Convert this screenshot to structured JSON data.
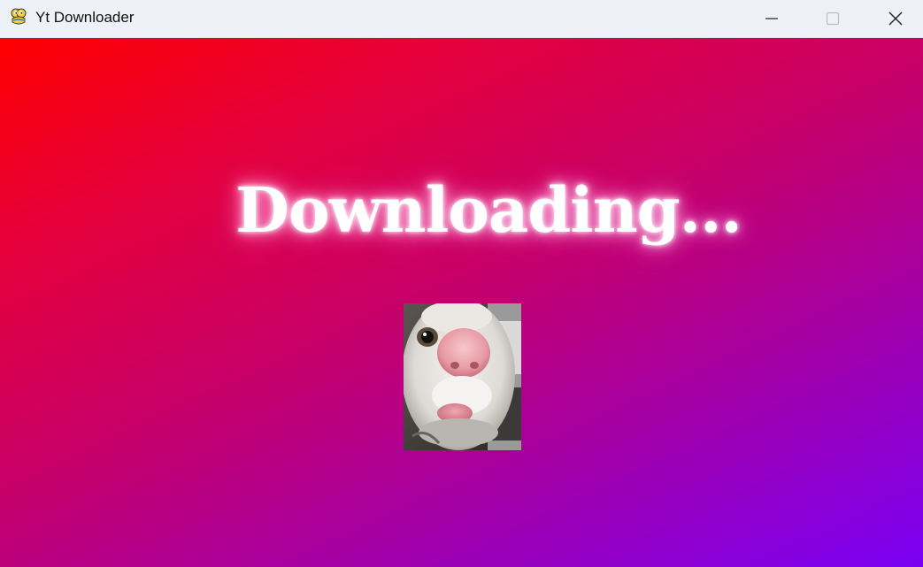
{
  "window": {
    "title": "Yt Downloader",
    "app_icon": "python-snake-icon",
    "controls": {
      "minimize_icon": "minimize-icon",
      "maximize_icon": "maximize-icon",
      "close_icon": "close-icon"
    }
  },
  "main": {
    "status_text": "Downloading...",
    "preview_image": "cat-closeup-image",
    "background_gradient": [
      "#ff0000",
      "#c6006a",
      "#7a00f5"
    ],
    "glow_color": "#ff9ee0"
  }
}
